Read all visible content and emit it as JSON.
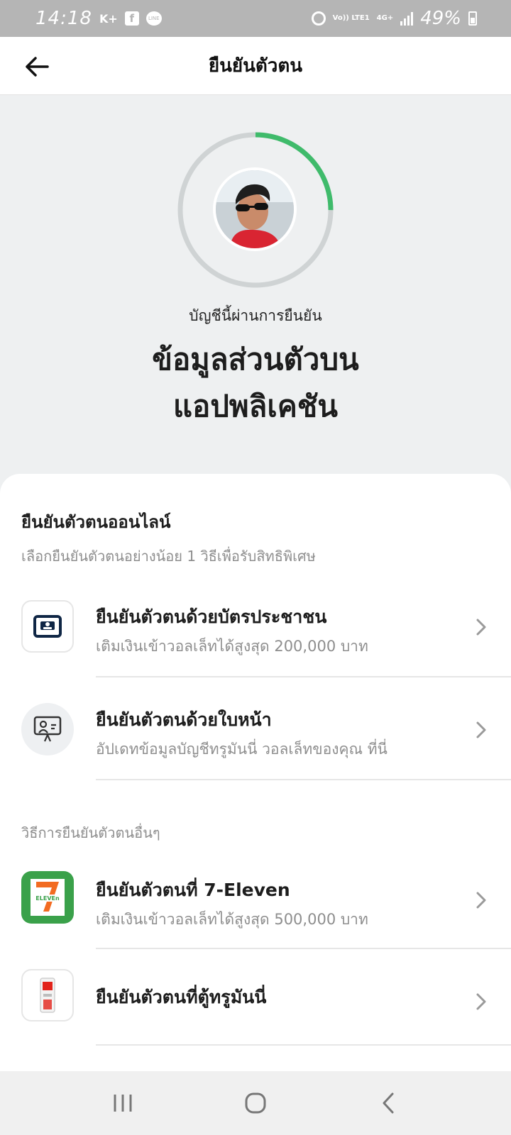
{
  "status_bar": {
    "time": "14:18",
    "carrier_text": "K+",
    "fb_label": "f",
    "line_label": "LINE",
    "volte_label": "Vo)) LTE1",
    "network_label": "4G+",
    "battery_percent": "49%",
    "icons": [
      "facebook-icon",
      "line-icon",
      "alarm-icon",
      "signal-icon",
      "battery-icon"
    ]
  },
  "header": {
    "title": "ยืนยันตัวตน",
    "back_icon": "arrow-left-icon"
  },
  "hero": {
    "progress_fraction": 0.25,
    "progress_color": "#3fbb6b",
    "track_color": "#cfd3d4",
    "verified_label": "บัญชีนี้ผ่านการยืนยัน",
    "title_line1": "ข้อมูลส่วนตัวบน",
    "title_line2": "แอปพลิเคชัน"
  },
  "online_section": {
    "title": "ยืนยันตัวตนออนไลน์",
    "subtitle": "เลือกยืนยันตัวตนอย่างน้อย 1 วิธีเพื่อรับสิทธิพิเศษ",
    "items": [
      {
        "title": "ยืนยันตัวตนด้วยบัตรประชาชน",
        "subtitle": "เติมเงินเข้าวอลเล็ทได้สูงสุด 200,000 บาท",
        "icon": "id-card-icon"
      },
      {
        "title": "ยืนยันตัวตนด้วยใบหน้า",
        "subtitle": "อัปเดทข้อมูลบัญชีทรูมันนี่ วอลเล็ทของคุณ ที่นี่",
        "icon": "face-verify-icon"
      }
    ]
  },
  "other_section": {
    "title": "วิธีการยืนยันตัวตนอื่นๆ",
    "items": [
      {
        "title": "ยืนยันตัวตนที่ 7-Eleven",
        "subtitle": "เติมเงินเข้าวอลเล็ทได้สูงสุด 500,000 บาท",
        "icon": "seven-eleven-icon",
        "logo_text": "ELEVEn"
      },
      {
        "title": "ยืนยันตัวตนที่ตู้ทรูมันนี่",
        "subtitle": "",
        "icon": "kiosk-icon"
      }
    ]
  },
  "nav_bar": {
    "icons": [
      "recent-apps-icon",
      "home-icon",
      "back-icon"
    ]
  },
  "colors": {
    "accent": "#3fbb6b",
    "seven_green": "#3aa14a",
    "seven_orange": "#f26b21",
    "seven_red": "#e2231a",
    "hero_bg": "#eef0f1"
  }
}
